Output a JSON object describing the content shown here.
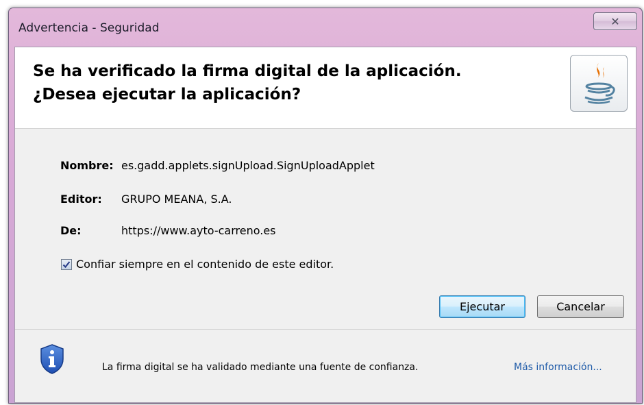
{
  "window": {
    "title": "Advertencia - Seguridad",
    "close_glyph": "✕"
  },
  "header": {
    "line1": "Se ha verificado la firma digital de la aplicación.",
    "line2": "¿Desea ejecutar la aplicación?",
    "icon": "java-logo-icon"
  },
  "fields": [
    {
      "label": "Nombre:",
      "value": "es.gadd.applets.signUpload.SignUploadApplet"
    },
    {
      "label": "Editor:",
      "value": "GRUPO MEANA, S.A."
    },
    {
      "label": "De:",
      "value": "https://www.ayto-carreno.es"
    }
  ],
  "trust_checkbox": {
    "label": "Confiar siempre en el contenido de este editor.",
    "checked": true
  },
  "buttons": {
    "run_label": "Ejecutar",
    "cancel_label": "Cancelar"
  },
  "footer": {
    "icon": "info-shield-icon",
    "text": "La firma digital se ha validado mediante una fuente de confianza.",
    "link": "Más información..."
  }
}
